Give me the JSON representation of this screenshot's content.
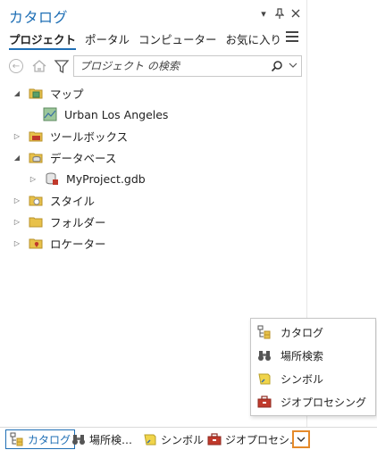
{
  "window": {
    "title": "カタログ"
  },
  "tabs": [
    {
      "label": "プロジェクト",
      "active": true
    },
    {
      "label": "ポータル"
    },
    {
      "label": "コンピューター"
    },
    {
      "label": "お気に入り"
    }
  ],
  "search": {
    "placeholder": "プロジェクト の検索",
    "value": ""
  },
  "tree": [
    {
      "label": "マップ",
      "icon": "map-folder-icon",
      "expanded": true
    },
    {
      "label": "Urban Los Angeles",
      "icon": "map-icon"
    },
    {
      "label": "ツールボックス",
      "icon": "toolbox-folder-icon",
      "expanded": false
    },
    {
      "label": "データベース",
      "icon": "database-folder-icon",
      "expanded": true
    },
    {
      "label": "MyProject.gdb",
      "icon": "geodatabase-icon",
      "expanded": false
    },
    {
      "label": "スタイル",
      "icon": "style-folder-icon",
      "expanded": false
    },
    {
      "label": "フォルダー",
      "icon": "folder-icon",
      "expanded": false
    },
    {
      "label": "ロケーター",
      "icon": "locator-folder-icon",
      "expanded": false
    }
  ],
  "bottom_tabs": [
    {
      "label": "カタログ",
      "icon": "catalog-icon",
      "active": true
    },
    {
      "label": "場所検…",
      "icon": "binoculars-icon"
    },
    {
      "label": "シンボル",
      "icon": "symbol-icon"
    },
    {
      "label": "ジオプロセシ…",
      "icon": "toolbox-icon"
    }
  ],
  "popup_items": [
    {
      "label": "カタログ",
      "icon": "catalog-icon"
    },
    {
      "label": "場所検索",
      "icon": "binoculars-icon"
    },
    {
      "label": "シンボル",
      "icon": "symbol-icon"
    },
    {
      "label": "ジオプロセシング",
      "icon": "toolbox-icon"
    }
  ],
  "colors": {
    "accent": "#1f6fb5",
    "highlight": "#e58a2a",
    "folder": "#e8c14a"
  }
}
